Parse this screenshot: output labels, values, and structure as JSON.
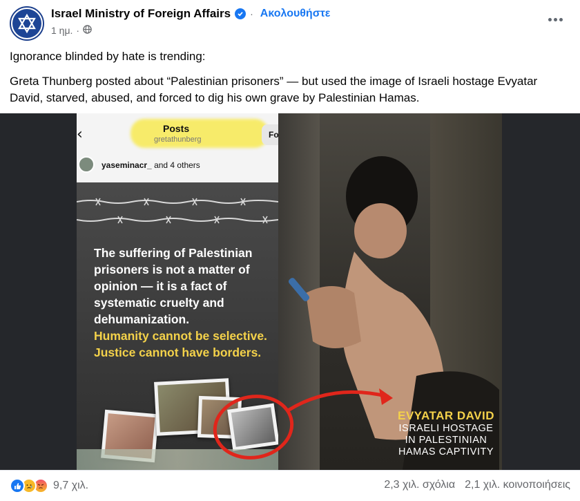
{
  "post": {
    "page_name": "Israel Ministry of Foreign Affairs",
    "follow_label": "Ακολουθήστε",
    "timestamp": "1 ημ.",
    "separator": "·",
    "text_line1": "Ignorance blinded by hate is trending:",
    "text_line2": "Greta Thunberg posted about “Palestinian prisoners” — but used the image of Israeli hostage Evyatar David, starved, abused, and forced to dig his own grave by Palestinian Hamas."
  },
  "media": {
    "ig_header": "Posts",
    "ig_handle": "gretathunberg",
    "ig_tab_partial": "Fo",
    "ig_liked_user": "yaseminacr_",
    "ig_liked_suffix": " and 4 others",
    "statement_white": "The suffering of Palestinian prisoners is not a matter of opinion — it is a fact of systematic cruelty and dehumanization.",
    "statement_yellow_1": "Humanity cannot be selective.",
    "statement_yellow_2": "Justice cannot have borders.",
    "caption_name": "EVYATAR DAVID",
    "caption_line1": "ISRAELI HOSTAGE",
    "caption_line2": "IN PALESTINIAN",
    "caption_line3": "HAMAS CAPTIVITY"
  },
  "footer": {
    "reaction_count": "9,7 χιλ.",
    "comments": "2,3 χιλ. σχόλια",
    "shares": "2,1 χιλ. κοινοποιήσεις"
  },
  "colors": {
    "accent": "#1877f2",
    "caption_yellow": "#f4d24a",
    "arrow_red": "#e0261b",
    "secondary_text": "#65676b"
  },
  "icons": [
    "star-of-david-icon",
    "verified-badge-icon",
    "globe-icon",
    "more-options-icon",
    "like-reaction-icon",
    "sad-reaction-icon",
    "angry-reaction-icon"
  ]
}
